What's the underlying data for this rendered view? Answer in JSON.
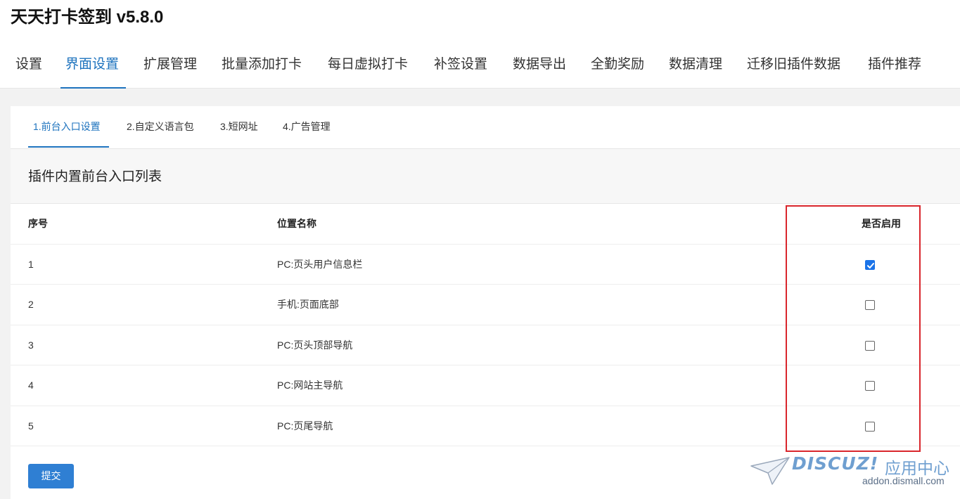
{
  "app": {
    "title": "天天打卡签到 v5.8.0"
  },
  "main_nav": {
    "tabs": [
      {
        "label": "设置"
      },
      {
        "label": "界面设置",
        "active": true
      },
      {
        "label": "扩展管理"
      },
      {
        "label": "批量添加打卡"
      },
      {
        "label": "每日虚拟打卡"
      },
      {
        "label": "补签设置"
      },
      {
        "label": "数据导出"
      },
      {
        "label": "全勤奖励"
      },
      {
        "label": "数据清理"
      },
      {
        "label": "迁移旧插件数据"
      },
      {
        "label": "插件推荐"
      }
    ]
  },
  "sub_nav": {
    "tabs": [
      {
        "label": "1.前台入口设置",
        "active": true
      },
      {
        "label": "2.自定义语言包"
      },
      {
        "label": "3.短网址"
      },
      {
        "label": "4.广告管理"
      }
    ]
  },
  "section": {
    "title": "插件内置前台入口列表"
  },
  "table": {
    "headers": {
      "index": "序号",
      "position": "位置名称",
      "enabled": "是否启用"
    },
    "rows": [
      {
        "index": "1",
        "position": "PC:页头用户信息栏",
        "enabled": true
      },
      {
        "index": "2",
        "position": "手机:页面底部",
        "enabled": false
      },
      {
        "index": "3",
        "position": "PC:页头顶部导航",
        "enabled": false
      },
      {
        "index": "4",
        "position": "PC:网站主导航",
        "enabled": false
      },
      {
        "index": "5",
        "position": "PC:页尾导航",
        "enabled": false
      }
    ]
  },
  "actions": {
    "submit_label": "提交"
  },
  "watermark": {
    "brand": "DISCUZ!",
    "brand_cn": "应用中心",
    "url": "addon.dismall.com"
  },
  "colors": {
    "accent": "#1e73be",
    "button": "#2f7fd3",
    "highlight": "#d9262c",
    "checkbox_on": "#1a73e8"
  }
}
